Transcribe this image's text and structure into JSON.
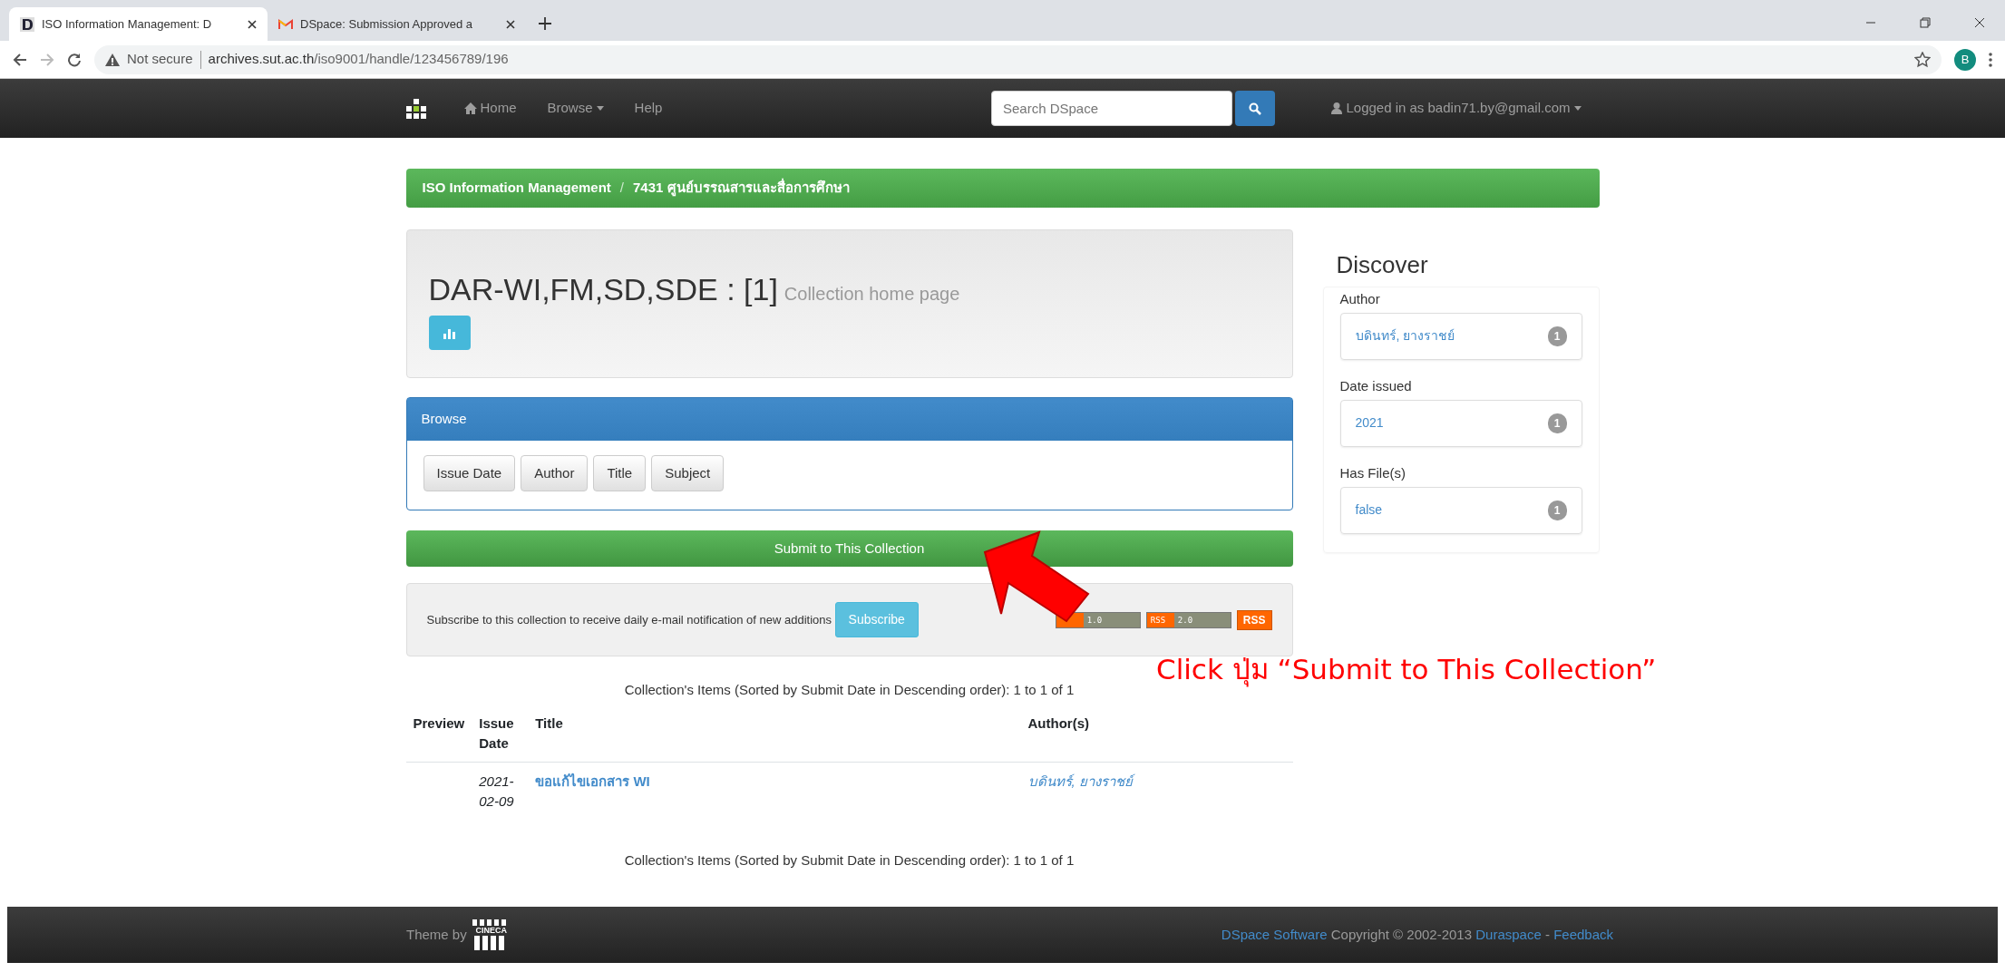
{
  "browser": {
    "tabs": [
      {
        "title": "ISO Information Management: D",
        "kind": "dspace",
        "selected": true
      },
      {
        "title": "DSpace: Submission Approved a",
        "kind": "mail",
        "selected": false
      }
    ],
    "security": "Not secure",
    "url_host": "archives.sut.ac.th",
    "url_path": "/iso9001/handle/123456789/196",
    "avatar": "B"
  },
  "navbar": {
    "items": [
      {
        "label": "Home",
        "kind": "home"
      },
      {
        "label": "Browse",
        "kind": "dropdown"
      },
      {
        "label": "Help",
        "kind": "link"
      }
    ],
    "search": {
      "placeholder": "Search DSpace"
    },
    "user": "Logged in as badin71.by@gmail.com"
  },
  "breadcrumb": {
    "items": [
      "ISO Information Management",
      "7431 ศูนย์บรรณสารและสื่อการศึกษา"
    ],
    "separator": "/"
  },
  "heading": {
    "title": "DAR-WI,FM,SD,SDE : [1]",
    "subtitle": "Collection home page"
  },
  "browse": {
    "title": "Browse",
    "buttons": [
      "Issue Date",
      "Author",
      "Title",
      "Subject"
    ]
  },
  "submit_button": "Submit to This Collection",
  "subscribe": {
    "text": "Subscribe to this collection to receive daily e-mail notification of new additions",
    "button": "Subscribe",
    "feeds": [
      {
        "kind": "versioned",
        "version": "1.0"
      },
      {
        "kind": "versioned",
        "label": "RSS",
        "version": "2.0"
      },
      {
        "kind": "plain",
        "label": "RSS"
      }
    ]
  },
  "items_caption_top": "Collection's Items (Sorted by Submit Date in Descending order): 1 to 1 of 1",
  "table": {
    "columns": [
      "Preview",
      "Issue Date",
      "Title",
      "Author(s)"
    ],
    "rows": [
      {
        "date": "2021-02-09",
        "title": "ขอแก้ไขเอกสาร WI",
        "author": "บดินทร์, ยางราชย์"
      }
    ]
  },
  "items_caption_bottom": "Collection's Items (Sorted by Submit Date in Descending order): 1 to 1 of 1",
  "discover": {
    "title": "Discover",
    "facets": [
      {
        "label": "Author",
        "value": "บดินทร์, ยางราชย์",
        "count": "1"
      },
      {
        "label": "Date issued",
        "value": "2021",
        "count": "1"
      },
      {
        "label": "Has File(s)",
        "value": "false",
        "count": "1"
      }
    ]
  },
  "annotation": "Click ปุ่ม “Submit to This Collection”",
  "footer": {
    "theme_by": "Theme by",
    "logo": "CINECA",
    "links": [
      {
        "text": "DSpace Software",
        "kind": "link"
      },
      {
        "text": "Copyright © 2002-2013",
        "kind": "text"
      },
      {
        "text": "Duraspace",
        "kind": "link"
      },
      {
        "text": "-",
        "kind": "text"
      },
      {
        "text": "Feedback",
        "kind": "link"
      }
    ]
  }
}
